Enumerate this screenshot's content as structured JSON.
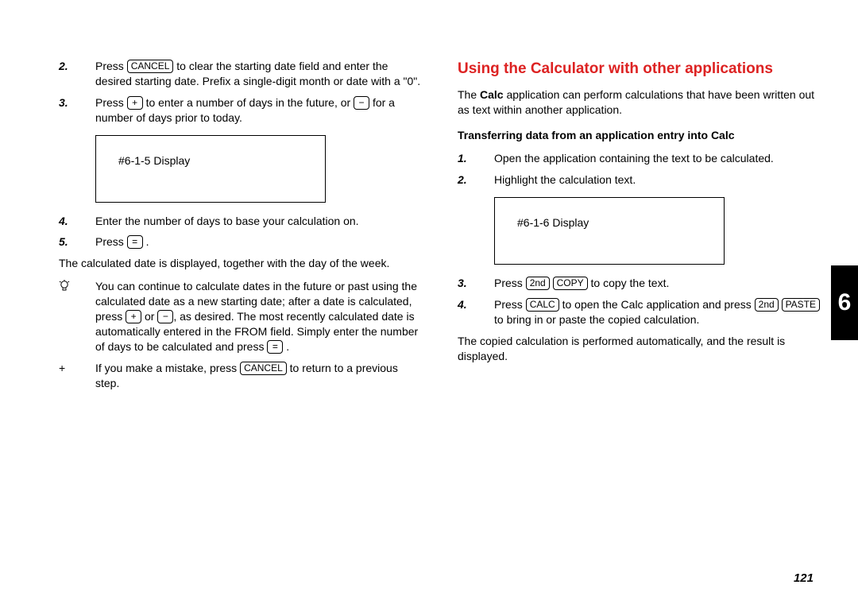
{
  "left": {
    "item2_num": "2.",
    "item2_a": "Press ",
    "item2_key": "CANCEL",
    "item2_b": " to clear the starting date field and enter the desired starting date. Prefix a single-digit month or date with a \"0\".",
    "item3_num": "3.",
    "item3_a": "Press ",
    "item3_key1": "+",
    "item3_b": " to enter a number of days in the future, or ",
    "item3_key2": "−",
    "item3_c": " for a number of days prior to today.",
    "display1": "#6-1-5 Display",
    "item4_num": "4.",
    "item4": "Enter the number of days to base your calculation on.",
    "item5_num": "5.",
    "item5_a": "Press ",
    "item5_key": "=",
    "item5_b": " .",
    "para1": "The calculated date is displayed, together with the day of the week.",
    "bulb_a": "You can continue to calculate dates in the future or past using the calculated date as a new starting date; after a date is calculated, press ",
    "bulb_k1": "+",
    "bulb_b": " or ",
    "bulb_k2": "−",
    "bulb_c": ", as desired. The most recently calculated date is automatically entered in the FROM field. Simply enter the number of days to be calculated and press ",
    "bulb_k3": "=",
    "bulb_d": " .",
    "plus_marker": "+",
    "plus_a": "If you make a mistake, press ",
    "plus_key": "CANCEL",
    "plus_b": " to return to a previous step."
  },
  "right": {
    "heading": "Using the Calculator with other applications",
    "intro_a": "The ",
    "intro_bold": "Calc",
    "intro_b": " application can perform calculations that have been written out as text within another application.",
    "sub": "Transferring data from an application entry into Calc",
    "r1_num": "1.",
    "r1": "Open the application containing the text to be calculated.",
    "r2_num": "2.",
    "r2": "Highlight the calculation text.",
    "display2": "#6-1-6 Display",
    "r3_num": "3.",
    "r3_a": "Press ",
    "r3_k1": "2nd",
    "r3_sp1": " ",
    "r3_k2": "COPY",
    "r3_b": " to copy the text.",
    "r4_num": "4.",
    "r4_a": "Press ",
    "r4_k1": "CALC",
    "r4_b": " to open the Calc application and press ",
    "r4_k2": "2nd",
    "r4_sp": " ",
    "r4_k3": "PASTE",
    "r4_c": " to bring in or paste the copied calculation.",
    "para2": "The copied calculation is performed automatically, and the result is displayed."
  },
  "tab": "6",
  "page_num": "121"
}
